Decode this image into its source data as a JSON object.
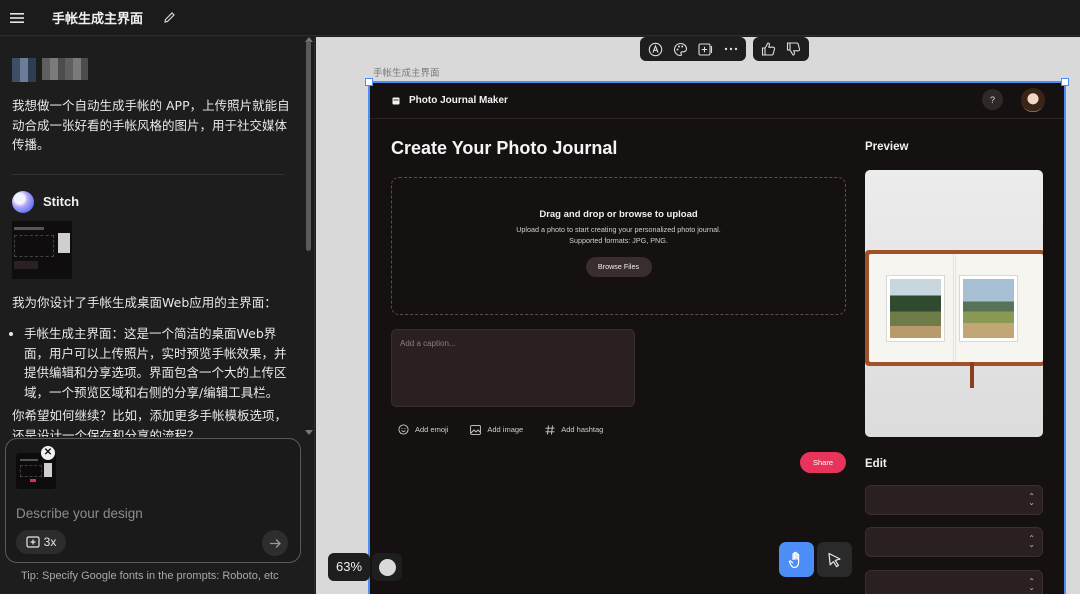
{
  "topbar": {
    "title": "手帐生成主界面"
  },
  "chat": {
    "user_message": "我想做一个自动生成手帐的 APP，上传照片就能自动合成一张好看的手帐风格的图片，用于社交媒体传播。",
    "bot_name": "Stitch",
    "bot_intro": "我为你设计了手帐生成桌面Web应用的主界面：",
    "bot_bullet": "手帐生成主界面：这是一个简洁的桌面Web界面，用户可以上传照片，实时预览手帐效果，并提供编辑和分享选项。界面包含一个大的上传区域，一个预览区域和右侧的分享/编辑工具栏。",
    "bot_question": "你希望如何继续？比如，添加更多手帐模板选项，还是设计一个保存和分享的流程？"
  },
  "prompt": {
    "placeholder": "Describe your design",
    "variants_label": "3x",
    "tip": "Tip: Specify Google fonts in the prompts: Roboto, etc"
  },
  "canvas": {
    "frame_label": "手帐生成主界面",
    "zoom": "63%",
    "toolbar_icons": [
      "font-icon",
      "palette-icon",
      "add-screen-icon",
      "more-icon",
      "thumbs-up-icon",
      "thumbs-down-icon"
    ]
  },
  "app": {
    "name": "Photo Journal Maker",
    "help": "?",
    "heading": "Create Your Photo Journal",
    "dropzone": {
      "title": "Drag and drop or browse to upload",
      "line1": "Upload a photo to start creating your personalized photo journal.",
      "line2": "Supported formats: JPG, PNG.",
      "button": "Browse Files"
    },
    "caption_placeholder": "Add a caption...",
    "tools": {
      "emoji": "Add emoji",
      "image": "Add image",
      "hashtag": "Add hashtag"
    },
    "share": "Share",
    "preview_heading": "Preview",
    "edit_heading": "Edit"
  },
  "colors": {
    "accent_blue": "#4d8df6",
    "share_pink": "#e8345b",
    "app_bg": "#151111"
  }
}
